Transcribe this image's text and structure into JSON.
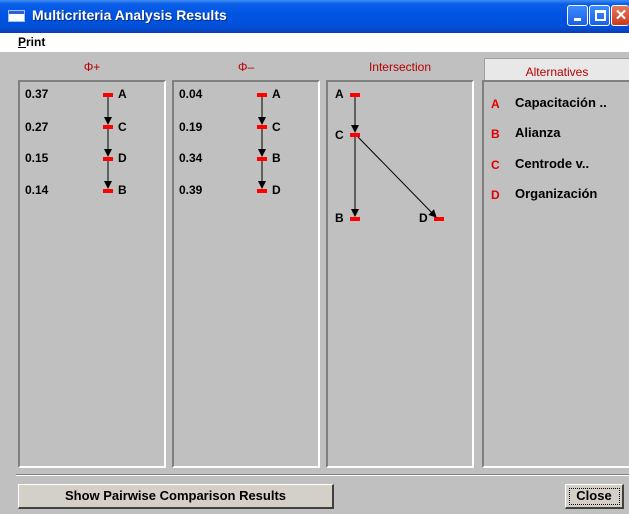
{
  "window": {
    "title": "Multicriteria Analysis Results"
  },
  "menu": {
    "print": "Print"
  },
  "columns": {
    "phi_plus": {
      "header": "Φ+",
      "rows": [
        {
          "value": "0.37",
          "label": "A"
        },
        {
          "value": "0.27",
          "label": "C"
        },
        {
          "value": "0.15",
          "label": "D"
        },
        {
          "value": "0.14",
          "label": "B"
        }
      ]
    },
    "phi_minus": {
      "header": "Φ–",
      "rows": [
        {
          "value": "0.04",
          "label": "A"
        },
        {
          "value": "0.19",
          "label": "C"
        },
        {
          "value": "0.34",
          "label": "B"
        },
        {
          "value": "0.39",
          "label": "D"
        }
      ]
    },
    "intersection": {
      "header": "Intersection",
      "nodes": [
        {
          "label": "A"
        },
        {
          "label": "C"
        },
        {
          "label": "B"
        },
        {
          "label": "D"
        }
      ]
    },
    "alternatives": {
      "header": "Alternatives",
      "items": [
        {
          "letter": "A",
          "name": "Capacitación .."
        },
        {
          "letter": "B",
          "name": "Alianza"
        },
        {
          "letter": "C",
          "name": "Centrode v.."
        },
        {
          "letter": "D",
          "name": "Organización"
        }
      ]
    }
  },
  "buttons": {
    "pairwise": "Show Pairwise Comparison Results",
    "close": "Close"
  },
  "colors": {
    "marker": "#ff0000",
    "header_text": "#b60000",
    "titlebar": "#0054e3"
  },
  "icons": {
    "app": "window-icon",
    "minimize": "minimize-icon",
    "maximize": "maximize-icon",
    "close": "close-x-icon"
  }
}
